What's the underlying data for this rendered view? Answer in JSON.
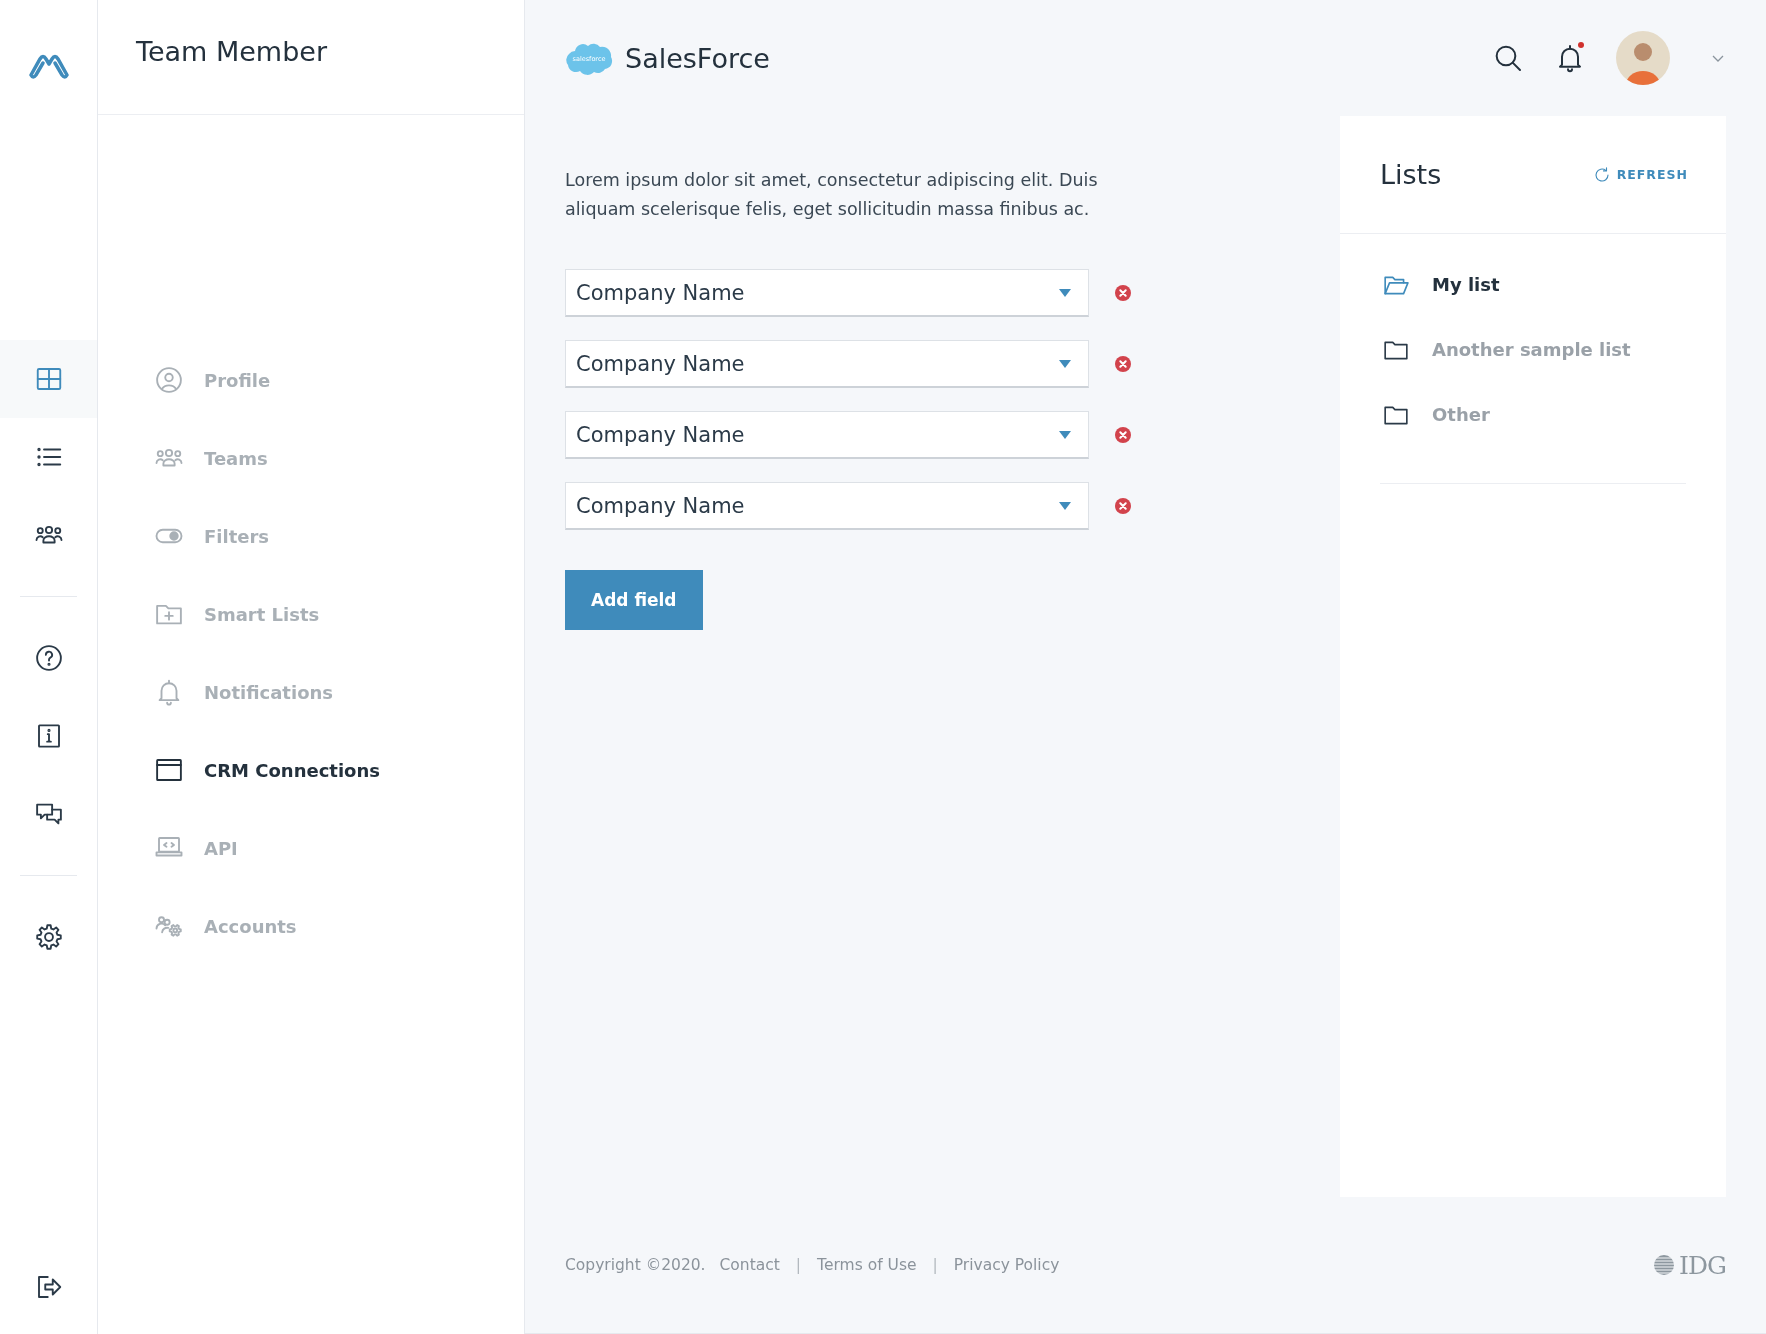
{
  "rail": {
    "groups": [
      [
        {
          "kind": "grid",
          "selected": true
        },
        {
          "kind": "list",
          "selected": false
        },
        {
          "kind": "team",
          "selected": false
        }
      ],
      [
        {
          "kind": "help",
          "selected": false
        },
        {
          "kind": "info",
          "selected": false
        },
        {
          "kind": "chat",
          "selected": false
        }
      ],
      [
        {
          "kind": "settings",
          "selected": false
        }
      ]
    ],
    "bottom": [
      {
        "kind": "logout",
        "selected": false
      }
    ]
  },
  "sidebar": {
    "title": "Team Member",
    "items": [
      {
        "label": "Profile",
        "kind": "profile",
        "selected": false
      },
      {
        "label": "Teams",
        "kind": "team",
        "selected": false
      },
      {
        "label": "Filters",
        "kind": "toggle",
        "selected": false
      },
      {
        "label": "Smart Lists",
        "kind": "folder-plus",
        "selected": false
      },
      {
        "label": "Notifications",
        "kind": "bell",
        "selected": false
      },
      {
        "label": "CRM Connections",
        "kind": "window",
        "selected": true
      },
      {
        "label": "API",
        "kind": "laptop",
        "selected": false
      },
      {
        "label": "Accounts",
        "kind": "accounts",
        "selected": false
      }
    ]
  },
  "header": {
    "logo_text": "salesforce",
    "title": "SalesForce",
    "notifications": {
      "unread": true
    }
  },
  "form": {
    "description": "Lorem ipsum dolor sit amet, consectetur adipiscing elit. Duis aliquam scelerisque felis, eget sollicitudin massa finibus ac.",
    "fields": [
      {
        "value": "Company Name"
      },
      {
        "value": "Company Name"
      },
      {
        "value": "Company Name"
      },
      {
        "value": "Company Name"
      }
    ],
    "add_button": "Add field"
  },
  "lists": {
    "title": "Lists",
    "refresh": "REFRESH",
    "items": [
      {
        "label": "My list",
        "selected": true
      },
      {
        "label": "Another sample list",
        "selected": false
      },
      {
        "label": "Other",
        "selected": false
      }
    ]
  },
  "footer": {
    "copyright": "Copyright ©2020.",
    "links": [
      {
        "kind": "link",
        "text": "Contact"
      },
      {
        "kind": "separator",
        "text": "|"
      },
      {
        "kind": "link",
        "text": "Terms of Use"
      },
      {
        "kind": "separator",
        "text": "|"
      },
      {
        "kind": "link",
        "text": "Privacy Policy"
      }
    ],
    "brand": "IDG"
  }
}
